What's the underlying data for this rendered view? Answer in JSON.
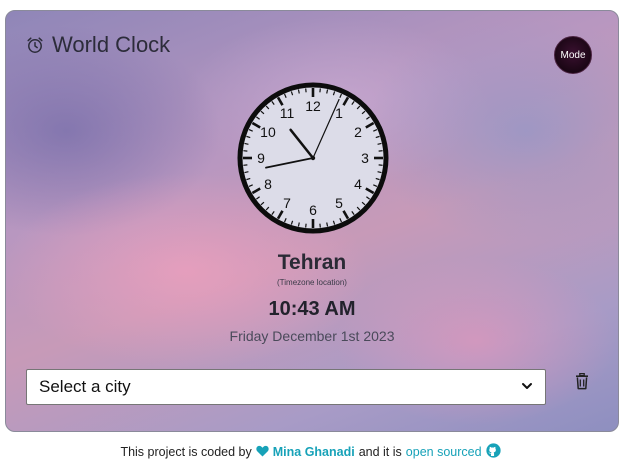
{
  "app": {
    "title": "World Clock",
    "icons": {
      "title": "alarm-clock-icon",
      "trash": "trash-icon",
      "heart": "heart-icon",
      "github": "github-icon"
    }
  },
  "mode_button": {
    "label": "Mode"
  },
  "clock": {
    "hour": 10,
    "minute": 43,
    "second": 4,
    "numerals": [
      "12",
      "1",
      "2",
      "3",
      "4",
      "5",
      "6",
      "7",
      "8",
      "9",
      "10",
      "11"
    ]
  },
  "location": {
    "city": "Tehran",
    "caption": "(Timezone location)",
    "time": "10:43 AM",
    "date": "Friday December 1st 2023"
  },
  "city_select": {
    "selected": "Select a city"
  },
  "footer": {
    "prefix": "This project is coded by",
    "author": "Mina Ghanadi",
    "middle": "and it is",
    "link": "open sourced"
  },
  "colors": {
    "accent": "#17a2b8",
    "text": "#2a2a35",
    "mode_bg": "#1a0614"
  }
}
